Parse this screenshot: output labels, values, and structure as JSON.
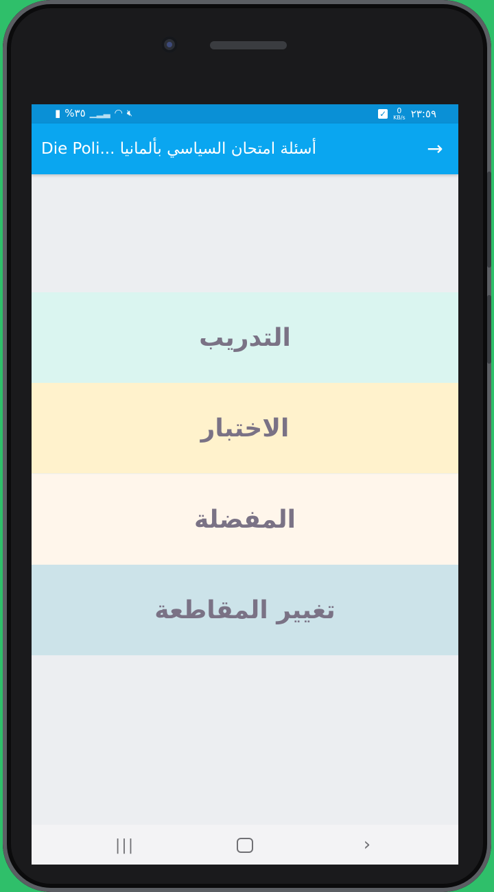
{
  "status_bar": {
    "time": "٢٣:٥٩",
    "data_speed_value": "0",
    "data_speed_unit": "KB/s",
    "battery": "%٣٥"
  },
  "app_bar": {
    "title": "أسئلة امتحان السياسي بألمانيا ...Die Poli",
    "back_icon": "arrow-right-icon"
  },
  "menu": {
    "training": "التدريب",
    "test": "الاختبار",
    "favorites": "المفضلة",
    "change_region": "تغيير المقاطعة"
  },
  "colors": {
    "status_bar": "#0a90d6",
    "app_bar": "#0aa6f0",
    "training_bg": "#daf5f0",
    "test_bg": "#fff2cc",
    "favorites_bg": "#fff6eb",
    "region_bg": "#cce3e9",
    "menu_text": "#7a7285"
  }
}
